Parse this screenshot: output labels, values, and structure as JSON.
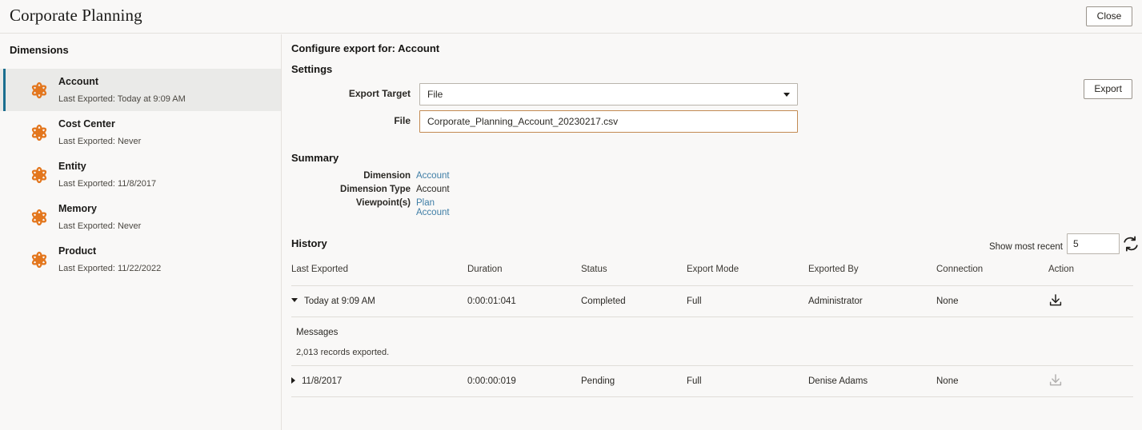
{
  "header": {
    "app_title": "Corporate Planning",
    "close_label": "Close"
  },
  "sidebar": {
    "title": "Dimensions",
    "items": [
      {
        "name": "Account",
        "sub": "Last Exported: Today at 9:09 AM",
        "icon": "dimension-icon",
        "selected": true
      },
      {
        "name": "Cost Center",
        "sub": "Last Exported: Never",
        "icon": "dimension-icon",
        "selected": false
      },
      {
        "name": "Entity",
        "sub": "Last Exported: 11/8/2017",
        "icon": "dimension-icon",
        "selected": false
      },
      {
        "name": "Memory",
        "sub": "Last Exported: Never",
        "icon": "dimension-icon",
        "selected": false
      },
      {
        "name": "Product",
        "sub": "Last Exported: 11/22/2022",
        "icon": "dimension-icon",
        "selected": false
      }
    ]
  },
  "main": {
    "configure_title": "Configure export for: Account",
    "export_label": "Export",
    "settings": {
      "title": "Settings",
      "export_target": {
        "label": "Export Target",
        "value": "File"
      },
      "file": {
        "label": "File",
        "value": "Corporate_Planning_Account_20230217.csv"
      }
    },
    "summary": {
      "title": "Summary",
      "rows": [
        {
          "label": "Dimension",
          "value": "Account",
          "link": true
        },
        {
          "label": "Dimension Type",
          "value": "Account",
          "link": false
        },
        {
          "label": "Viewpoint(s)",
          "value": "Plan Account",
          "link": true
        }
      ]
    },
    "history": {
      "title": "History",
      "show_most_recent_label": "Show most recent",
      "show_most_recent_value": "5",
      "refresh_icon": "refresh-icon",
      "columns": [
        "Last Exported",
        "Duration",
        "Status",
        "Export Mode",
        "Exported By",
        "Connection",
        "Action"
      ],
      "rows": [
        {
          "last_exported": "Today at 9:09 AM",
          "duration": "0:00:01:041",
          "status": "Completed",
          "export_mode": "Full",
          "exported_by": "Administrator",
          "connection": "None",
          "expanded": true,
          "download_enabled": true,
          "messages_title": "Messages",
          "messages_body": "2,013 records exported."
        },
        {
          "last_exported": "11/8/2017",
          "duration": "0:00:00:019",
          "status": "Pending",
          "export_mode": "Full",
          "exported_by": "Denise Adams",
          "connection": "None",
          "expanded": false,
          "download_enabled": false
        }
      ]
    }
  },
  "colors": {
    "accent": "#1b6e8f",
    "icon_orange": "#e3761d",
    "link": "#3f7ea6",
    "field_highlight": "#c28a52",
    "page_bg": "#f9f8f7",
    "selected_bg": "#eaeae8"
  }
}
